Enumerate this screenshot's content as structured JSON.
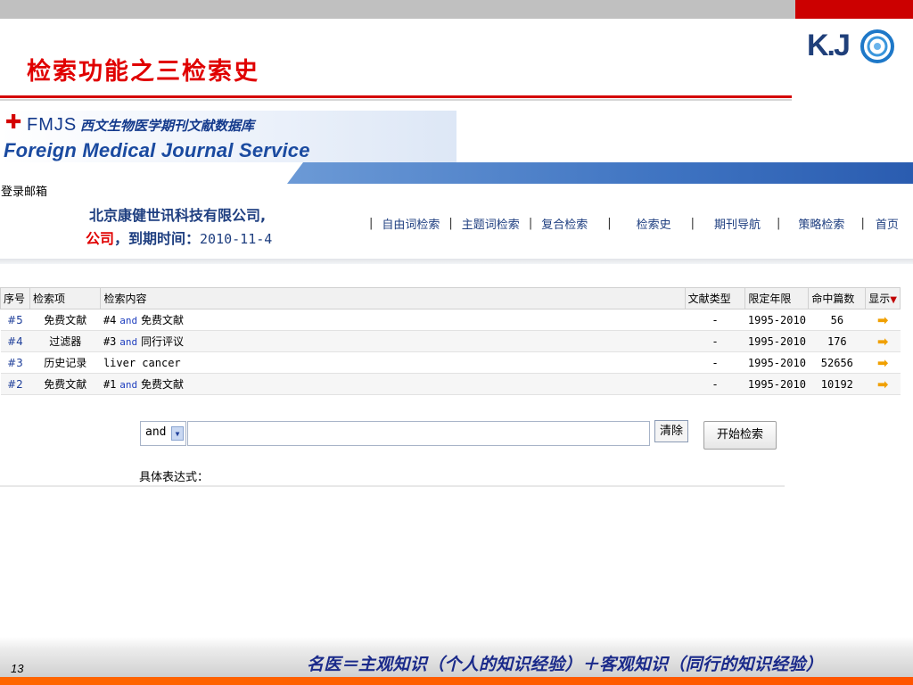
{
  "slide": {
    "title": "检索功能之三检索史",
    "page_number": "13",
    "footer_quote": "名医＝主观知识（个人的知识经验）＋客观知识（同行的知识经验）",
    "logo_text": "K.J",
    "colors": {
      "title": "#e00000",
      "top_red": "#cc0000",
      "footer_orange": "#ff6600",
      "brand_blue": "#143a8c"
    }
  },
  "app": {
    "brand_cross": "✚",
    "brand_short": "FMJS",
    "brand_cn": "西文生物医学期刊文献数据库",
    "brand_en": "Foreign Medical Journal Service",
    "login_mail": "登录邮箱",
    "company_line1": "北京康健世讯科技有限公司,",
    "company_line2_prefix": "公司",
    "company_line2_mid": "，到期时间：",
    "expiry_date": "2010-11-4",
    "nav_items": [
      "自由词检索",
      "主题词检索",
      "复合检索",
      "检索史",
      "期刊导航",
      "策略检索",
      "首页"
    ]
  },
  "history_table": {
    "headers": {
      "no": "序号",
      "field": "检索项",
      "content": "检索内容",
      "doc_type": "文献类型",
      "years": "限定年限",
      "hits": "命中篇数",
      "show": "显示"
    },
    "sort_icon": "▼",
    "rows": [
      {
        "no": "#5",
        "field": "免费文献",
        "ref": "#4",
        "op": "and",
        "term": "免费文献",
        "doc_type": "-",
        "years": "1995-2010",
        "hits": "56",
        "show": "➡"
      },
      {
        "no": "#4",
        "field": "过滤器",
        "ref": "#3",
        "op": "and",
        "term": "同行评议",
        "doc_type": "-",
        "years": "1995-2010",
        "hits": "176",
        "show": "➡"
      },
      {
        "no": "#3",
        "field": "历史记录",
        "ref": "",
        "op": "",
        "term": "liver cancer",
        "doc_type": "-",
        "years": "1995-2010",
        "hits": "52656",
        "show": "➡"
      },
      {
        "no": "#2",
        "field": "免费文献",
        "ref": "#1",
        "op": "and",
        "term": "免费文献",
        "doc_type": "-",
        "years": "1995-2010",
        "hits": "10192",
        "show": "➡"
      }
    ]
  },
  "query_form": {
    "operator": "and",
    "dropdown_glyph": "▼",
    "query_value": "",
    "clear_label": "清除",
    "search_label": "开始检索",
    "expression_label": "具体表达式："
  }
}
